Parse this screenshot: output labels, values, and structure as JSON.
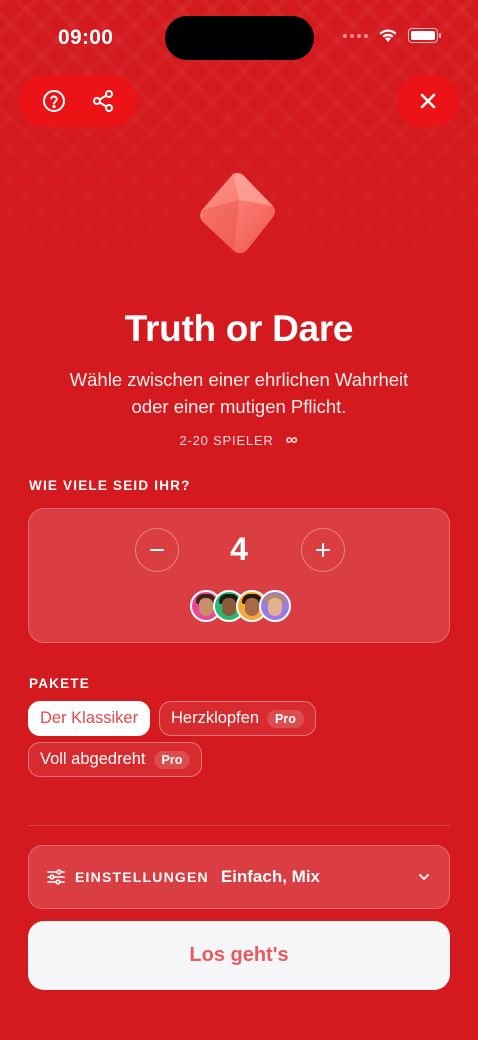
{
  "status": {
    "time": "09:00"
  },
  "hero": {
    "title": "Truth or Dare",
    "subtitle_line1": "Wähle zwischen einer ehrlichen Wahrheit",
    "subtitle_line2": "oder einer mutigen Pflicht.",
    "players_range": "2-20 SPIELER",
    "infinity": "∞"
  },
  "players": {
    "label": "WIE VIELE SEID IHR?",
    "count": "4",
    "minus": "−",
    "plus": "+"
  },
  "packs": {
    "label": "PAKETE",
    "items": [
      {
        "label": "Der Klassiker",
        "badge": ""
      },
      {
        "label": "Herzklopfen",
        "badge": "Pro"
      },
      {
        "label": "Voll abgedreht",
        "badge": "Pro"
      }
    ]
  },
  "settings": {
    "label": "EINSTELLUNGEN",
    "value": "Einfach, Mix"
  },
  "start": {
    "label": "Los geht's"
  },
  "colors": {
    "background": "#d41a1e",
    "accent": "#ec1317",
    "button_text": "#e85a5e"
  },
  "icons": [
    "help-icon",
    "share-icon",
    "close-icon",
    "gem-icon",
    "sliders-icon",
    "chevron-down-icon"
  ]
}
